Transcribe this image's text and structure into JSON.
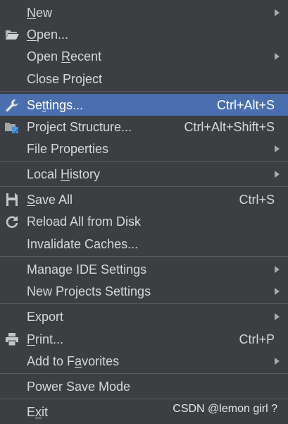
{
  "menu": {
    "items": {
      "new": {
        "label": "New",
        "has_submenu": true
      },
      "open": {
        "label": "Open...",
        "icon": "folder-open-icon"
      },
      "open_recent": {
        "label": "Open Recent",
        "has_submenu": true
      },
      "close_project": {
        "label": "Close Project"
      },
      "settings": {
        "label": "Settings...",
        "shortcut": "Ctrl+Alt+S",
        "icon": "wrench-icon",
        "selected": true
      },
      "project_structure": {
        "label": "Project Structure...",
        "shortcut": "Ctrl+Alt+Shift+S",
        "icon": "project-structure-icon"
      },
      "file_properties": {
        "label": "File Properties",
        "has_submenu": true
      },
      "local_history": {
        "label": "Local History",
        "has_submenu": true
      },
      "save_all": {
        "label": "Save All",
        "shortcut": "Ctrl+S",
        "icon": "floppy-disk-icon"
      },
      "reload_all": {
        "label": "Reload All from Disk",
        "icon": "reload-icon"
      },
      "invalidate_caches": {
        "label": "Invalidate Caches..."
      },
      "manage_ide_settings": {
        "label": "Manage IDE Settings",
        "has_submenu": true
      },
      "new_projects_settings": {
        "label": "New Projects Settings",
        "has_submenu": true
      },
      "export": {
        "label": "Export",
        "has_submenu": true
      },
      "print": {
        "label": "Print...",
        "shortcut": "Ctrl+P",
        "icon": "printer-icon"
      },
      "add_to_favorites": {
        "label": "Add to Favorites",
        "has_submenu": true
      },
      "power_save_mode": {
        "label": "Power Save Mode"
      },
      "exit": {
        "label": "Exit"
      }
    }
  },
  "watermark": "CSDN @lemon girl ?",
  "colors": {
    "background": "#3c3f41",
    "selected": "#4b6eaf",
    "text": "#d7d7d7",
    "separator": "#5a5d5f"
  }
}
